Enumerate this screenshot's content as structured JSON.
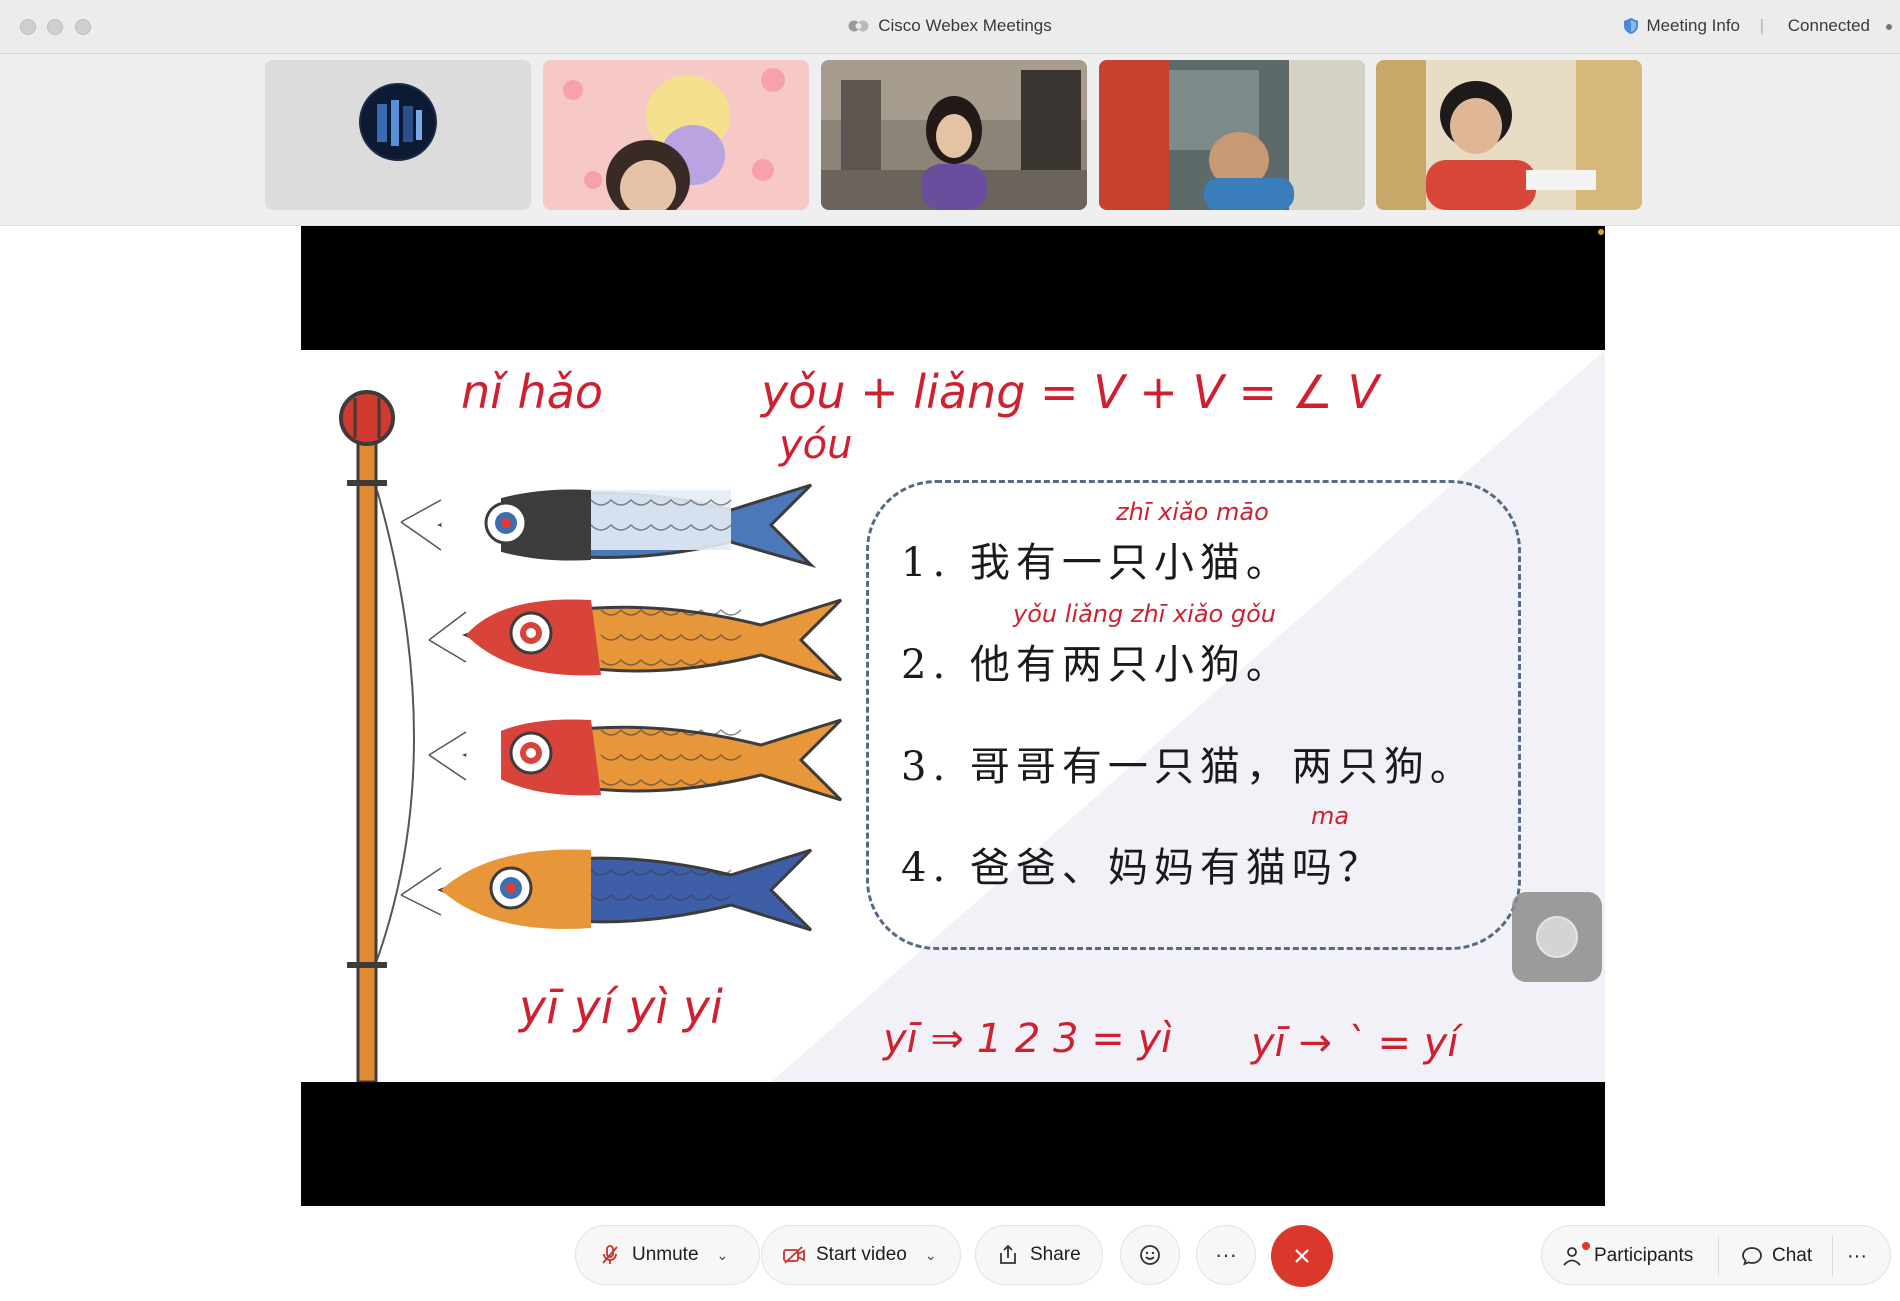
{
  "window": {
    "title": "Cisco Webex Meetings",
    "meeting_info": "Meeting Info",
    "separator": "|",
    "status": "Connected"
  },
  "slide": {
    "sentences": [
      "1. 我有一只小猫。",
      "2. 他有两只小狗。",
      "3. 哥哥有一只猫，两只狗。",
      "4. 爸爸、妈妈有猫吗？"
    ],
    "annotations": {
      "ni_hao": "nǐ hǎo",
      "you_liang": "yǒu + liǎng  =  V + V  =  ∠ V",
      "you": "yóu",
      "zhi_xiao_mao": "zhī xiǎo māo",
      "you_liang_zhi": "yǒu liǎng zhī xiǎo gǒu",
      "ma": "ma",
      "yi_tones": "yī yí yì   yi",
      "yi_rule_1": "yī ⇒ 1 2 3 = yì",
      "yi_rule_2": "yī → ` = yí"
    }
  },
  "toolbar": {
    "unmute": "Unmute",
    "start_video": "Start video",
    "share": "Share",
    "more": "···",
    "participants": "Participants",
    "chat": "Chat",
    "overflow": "···"
  },
  "colors": {
    "leave_red": "#d9382a",
    "ink_red": "#d01f2f",
    "box_border": "#546a85"
  }
}
